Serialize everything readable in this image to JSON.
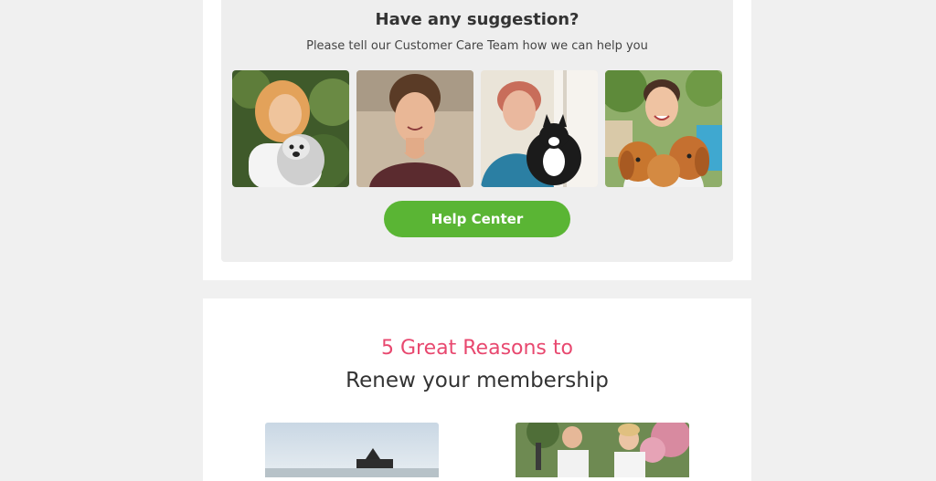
{
  "suggestion": {
    "title": "Have any suggestion?",
    "subtitle": "Please tell our Customer Care Team how we can help you",
    "photos": [
      {
        "icon": "woman-with-dog-photo"
      },
      {
        "icon": "woman-portrait-photo"
      },
      {
        "icon": "woman-with-cat-photo"
      },
      {
        "icon": "woman-with-puppies-photo"
      }
    ],
    "button_label": "Help Center"
  },
  "reasons": {
    "title_line1": "5 Great Reasons to",
    "title_line2": "Renew your membership"
  },
  "colors": {
    "page_background": "#f0f0f0",
    "panel_background": "#eeeeee",
    "button_green": "#5ab534",
    "accent_pink": "#e8486f",
    "text_dark": "#333333"
  }
}
